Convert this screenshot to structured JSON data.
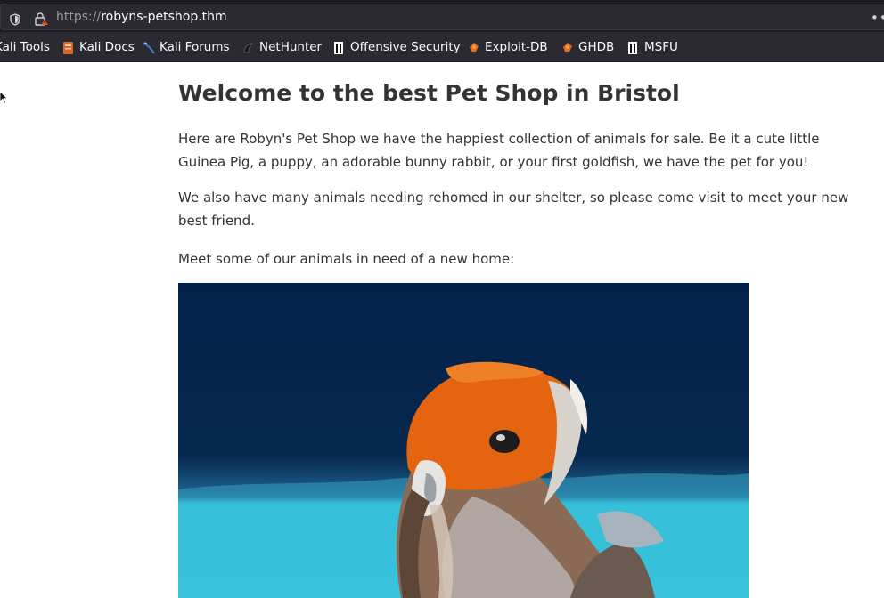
{
  "browser": {
    "url_scheme": "https://",
    "url_host": "robyns-petshop.thm",
    "more_menu": "•••",
    "bookmarks": [
      {
        "label": "Kali Tools",
        "icon": "kali-icon"
      },
      {
        "label": "Kali Docs",
        "icon": "kali-docs-icon"
      },
      {
        "label": "Kali Forums",
        "icon": "kali-forums-icon"
      },
      {
        "label": "NetHunter",
        "icon": "nethunter-icon"
      },
      {
        "label": "Offensive Security",
        "icon": "offsec-icon"
      },
      {
        "label": "Exploit-DB",
        "icon": "exploit-db-icon"
      },
      {
        "label": "GHDB",
        "icon": "ghdb-icon"
      },
      {
        "label": "MSFU",
        "icon": "msfu-icon"
      }
    ]
  },
  "page": {
    "heading": "Welcome to the best Pet Shop in Bristol",
    "paragraphs": [
      "Here are Robyn's Pet Shop we have the happiest collection of animals for sale. Be it a cute little Guinea Pig, a puppy, an adorable bunny rabbit, or your first goldfish, we have the pet for you!",
      "We also have many animals needing rehomed in our shelter, so please come visit to meet your new best friend.",
      "Meet some of our animals in need of a new home:"
    ],
    "photo_subject": "goldfish"
  },
  "colors": {
    "chrome_dark": "#1c1b22",
    "chrome_bar": "#2b2a33",
    "text": "#333333",
    "photo_background": "#05234a",
    "photo_water": "#36bfd9",
    "fish_orange": "#e4640f"
  }
}
